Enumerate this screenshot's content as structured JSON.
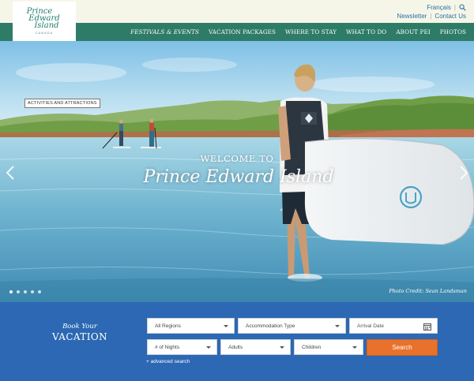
{
  "brand": {
    "logo_line1": "Prince",
    "logo_line2": "Edward",
    "logo_line3": "Island",
    "logo_country": "CANADA"
  },
  "utility": {
    "language": "Français",
    "newsletter": "Newsletter",
    "contact": "Contact Us",
    "separator": "|"
  },
  "nav": {
    "items": [
      {
        "label": "FESTIVALS & EVENTS"
      },
      {
        "label": "VACATION PACKAGES"
      },
      {
        "label": "WHERE TO STAY"
      },
      {
        "label": "WHAT TO DO"
      },
      {
        "label": "ABOUT PEI"
      },
      {
        "label": "PHOTOS"
      }
    ]
  },
  "hero": {
    "tag": "ACTIVITIES AND ATTRACTIONS",
    "welcome": "WELCOME TO",
    "title": "Prince Edward Island",
    "credit": "Photo Credit: Sean Landsman",
    "slide_count": 5,
    "active_slide": 1
  },
  "booking": {
    "title_line1": "Book Your",
    "title_line2": "VACATION",
    "regions": "All Regions",
    "accommodation": "Accommodation Type",
    "arrival_placeholder": "Arrival Date",
    "nights": "# of Nights",
    "adults": "Adults",
    "children": "Children",
    "search_label": "Search",
    "advanced": "+ advanced search"
  },
  "colors": {
    "nav_green": "#2e7c68",
    "booking_blue": "#2c68b3",
    "search_orange": "#e8712b",
    "link_blue": "#2a6fa6"
  }
}
